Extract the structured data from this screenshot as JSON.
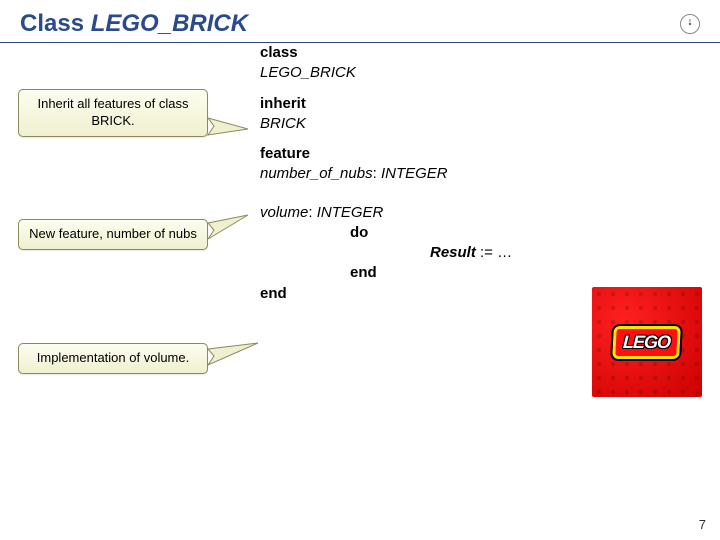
{
  "header": {
    "title_prefix": "Class ",
    "title_class": "LEGO_BRICK"
  },
  "callouts": {
    "inherit": "Inherit all features of class BRICK.",
    "newfeature": "New feature, number of nubs",
    "impl": "Implementation of volume."
  },
  "code": {
    "l1": "class",
    "l2": "LEGO_BRICK",
    "l3": "inherit",
    "l4": "BRICK",
    "l5": "feature",
    "l6a": "number_of_nubs",
    "l6b": ": ",
    "l6c": "INTEGER",
    "l7a": "volume",
    "l7b": ": ",
    "l7c": "INTEGER",
    "l8": "do",
    "l9a": "Result",
    "l9b": " := …",
    "l10": "end",
    "l11": "end"
  },
  "lego": {
    "word": "LEGO"
  },
  "page": "7"
}
